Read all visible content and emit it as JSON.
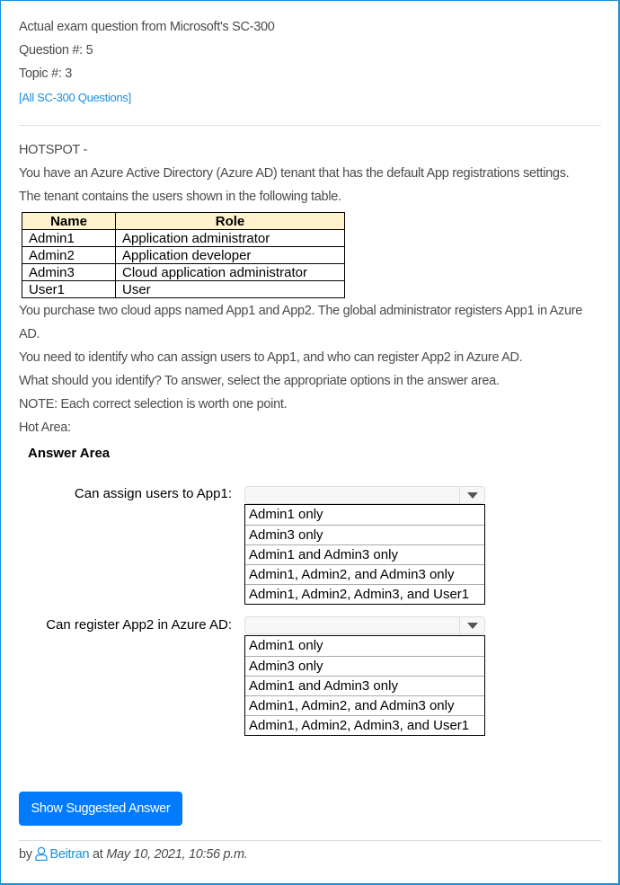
{
  "header": {
    "line1": "Actual exam question from Microsoft's SC-300",
    "question": "Question #: 5",
    "topic": "Topic #: 3",
    "all_link": "[All SC-300 Questions]"
  },
  "body": {
    "hotspot": "HOTSPOT -",
    "p1": "You have an Azure Active Directory (Azure AD) tenant that has the default App registrations settings.",
    "p2": "The tenant contains the users shown in the following table.",
    "p3a": "You purchase two cloud apps named App1 and App2. The global administrator registers App1 in Azure",
    "p3b": "AD.",
    "p4": "You need to identify who can assign users to App1, and who can register App2 in Azure AD.",
    "p5": "What should you identify? To answer, select the appropriate options in the answer area.",
    "p6": "NOTE: Each correct selection is worth one point.",
    "p7": "Hot Area:"
  },
  "table": {
    "headers": [
      "Name",
      "Role"
    ],
    "rows": [
      [
        "Admin1",
        "Application administrator"
      ],
      [
        "Admin2",
        "Application developer"
      ],
      [
        "Admin3",
        "Cloud application administrator"
      ],
      [
        "User1",
        "User"
      ]
    ]
  },
  "answer_area": {
    "title": "Answer Area",
    "questions": [
      {
        "label": "Can assign users to App1:",
        "options": [
          "Admin1 only",
          "Admin3 only",
          "Admin1 and Admin3 only",
          "Admin1, Admin2, and Admin3 only",
          "Admin1, Admin2, Admin3, and User1"
        ]
      },
      {
        "label": "Can register App2 in Azure AD:",
        "options": [
          "Admin1 only",
          "Admin3 only",
          "Admin1 and Admin3 only",
          "Admin1, Admin2, and Admin3 only",
          "Admin1, Admin2, Admin3, and User1"
        ]
      }
    ]
  },
  "button": "Show Suggested Answer",
  "footer": {
    "by": "by",
    "user": "Beitran",
    "at": "at",
    "date": "May 10, 2021, 10:56 p.m."
  }
}
